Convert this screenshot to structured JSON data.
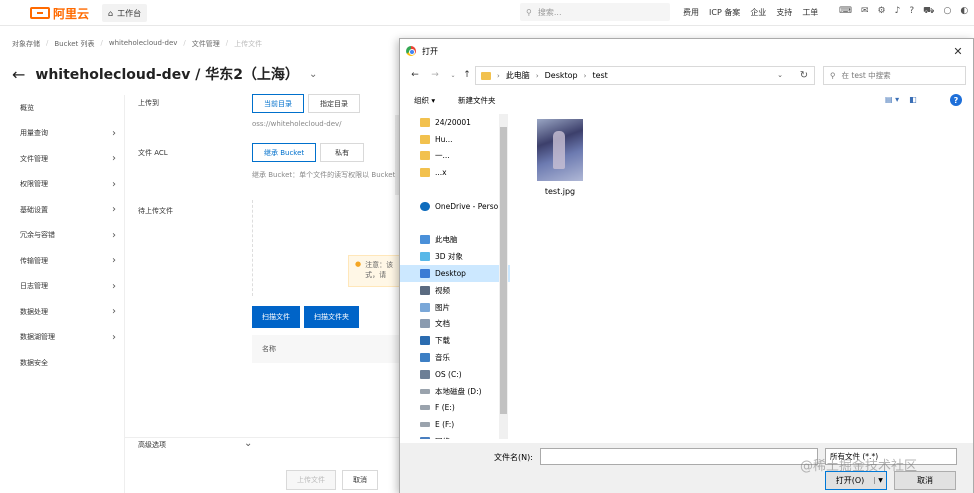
{
  "console": {
    "logo_text": "阿里云",
    "workbench_label": "工作台",
    "search_placeholder": "搜索...",
    "top_nav": [
      "费用",
      "ICP 备案",
      "企业",
      "支持",
      "工单"
    ],
    "breadcrumb": [
      "对象存储",
      "Bucket 列表",
      "whiteholecloud-dev",
      "文件管理",
      "上传文件"
    ],
    "bucket_name": "whiteholecloud-dev / 华东2（上海）",
    "menu": [
      {
        "label": "概览",
        "chevron": false
      },
      {
        "label": "用量查询",
        "chevron": true
      },
      {
        "label": "文件管理",
        "chevron": true
      },
      {
        "label": "权限管理",
        "chevron": true
      },
      {
        "label": "基础设置",
        "chevron": true
      },
      {
        "label": "冗余与容错",
        "chevron": true
      },
      {
        "label": "传输管理",
        "chevron": true
      },
      {
        "label": "日志管理",
        "chevron": true
      },
      {
        "label": "数据处理",
        "chevron": true
      },
      {
        "label": "数据湖管理",
        "chevron": true
      },
      {
        "label": "数据安全",
        "chevron": false
      }
    ],
    "upload_to_label": "上传到",
    "upload_to_options": [
      "当前目录",
      "指定目录"
    ],
    "upload_path": "oss://whiteholecloud-dev/",
    "acl_label": "文件 ACL",
    "acl_options": [
      "继承 Bucket",
      "私有"
    ],
    "acl_hint": "继承 Bucket：单个文件的读写权限以 Bucket",
    "pending_label": "待上传文件",
    "notice_text": "注意：该\n式，请",
    "scan_files_label": "扫描文件",
    "scan_folder_label": "扫描文件夹",
    "table_name_header": "名称",
    "advanced_label": "高级选项",
    "upload_button": "上传文件",
    "cancel_button": "取消"
  },
  "dialog": {
    "title": "打开",
    "address": [
      "此电脑",
      "Desktop",
      "test"
    ],
    "search_placeholder": "在 test 中搜索",
    "organize_label": "组织",
    "new_folder_label": "新建文件夹",
    "tree": [
      {
        "label": "24/20001",
        "icon": "folder",
        "selected": false
      },
      {
        "label": "Hu...",
        "icon": "folder",
        "selected": false
      },
      {
        "label": "一...",
        "icon": "folder",
        "selected": false
      },
      {
        "label": "...x",
        "icon": "folder",
        "selected": false
      },
      {
        "label": "",
        "icon": "blank",
        "selected": false
      },
      {
        "label": "OneDrive - Perso",
        "icon": "cloud",
        "selected": false
      },
      {
        "label": "",
        "icon": "blank",
        "selected": false
      },
      {
        "label": "此电脑",
        "icon": "computer",
        "selected": false
      },
      {
        "label": "3D 对象",
        "icon": "3d",
        "selected": false
      },
      {
        "label": "Desktop",
        "icon": "desktop",
        "selected": true
      },
      {
        "label": "视频",
        "icon": "video",
        "selected": false
      },
      {
        "label": "图片",
        "icon": "pictures",
        "selected": false
      },
      {
        "label": "文档",
        "icon": "documents",
        "selected": false
      },
      {
        "label": "下载",
        "icon": "downloads",
        "selected": false
      },
      {
        "label": "音乐",
        "icon": "music",
        "selected": false
      },
      {
        "label": "OS (C:)",
        "icon": "drive-os",
        "selected": false
      },
      {
        "label": "本地磁盘 (D:)",
        "icon": "drive",
        "selected": false
      },
      {
        "label": "F (E:)",
        "icon": "drive",
        "selected": false
      },
      {
        "label": "E (F:)",
        "icon": "drive",
        "selected": false
      },
      {
        "label": "网络",
        "icon": "network",
        "selected": false
      }
    ],
    "file": {
      "name": "test.jpg"
    },
    "filename_label": "文件名(N):",
    "filename_value": "",
    "filetype_value": "所有文件 (*.*)",
    "open_button": "打开(O)",
    "cancel_button": "取消"
  },
  "watermark": "@稀土掘金技术社区",
  "colors": {
    "brand": "#ff6a00",
    "primary": "#0064c8",
    "selection": "#cce8ff"
  }
}
